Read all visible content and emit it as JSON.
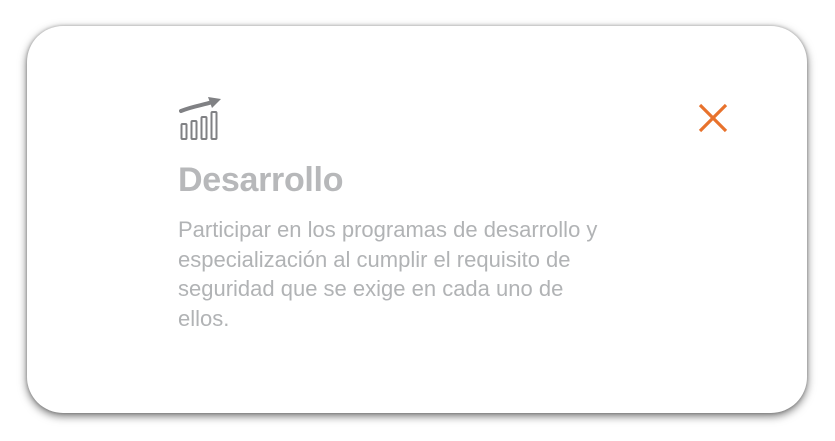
{
  "modal": {
    "title": "Desarrollo",
    "description": "Participar en los programas de desarrollo y especialización al cumplir el requisito de seguridad que se exige en cada uno de ellos.",
    "icon": "growth-bars-icon",
    "close_icon": "close-icon"
  },
  "colors": {
    "text_gray": "#b1b3b5",
    "icon_gray": "#808184",
    "accent_orange": "#e8722c",
    "background": "#ffffff"
  }
}
